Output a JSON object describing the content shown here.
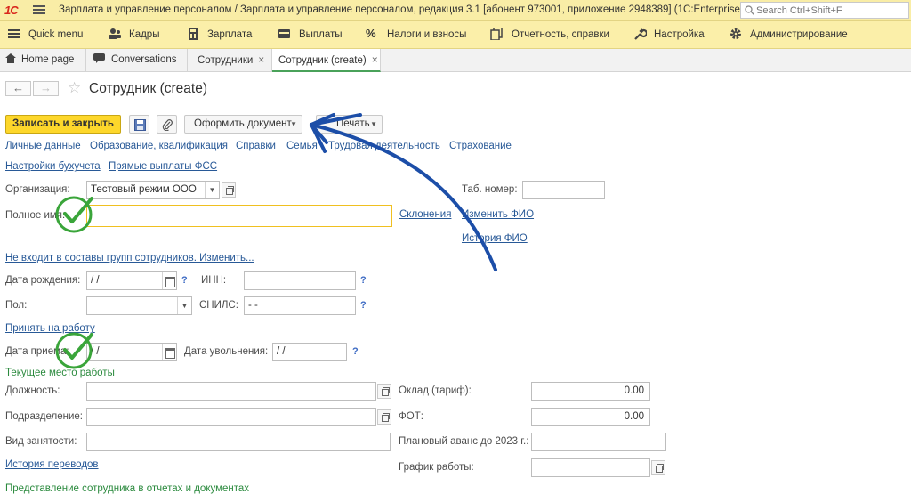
{
  "titlebar": {
    "logo": "1С",
    "title": "Зарплата и управление персоналом / Зарплата и управление персоналом, редакция 3.1 [абонент 973001, приложение 2948389]  (1C:Enterprise)",
    "search_placeholder": "Search Ctrl+Shift+F"
  },
  "menubar": {
    "items": [
      {
        "label": "Quick menu",
        "icon": "hamburger-icon"
      },
      {
        "label": "Кадры",
        "icon": "people-icon"
      },
      {
        "label": "Зарплата",
        "icon": "calculator-icon"
      },
      {
        "label": "Выплаты",
        "icon": "wallet-icon"
      },
      {
        "label": "Налоги и взносы",
        "icon": "percent-icon"
      },
      {
        "label": "Отчетность, справки",
        "icon": "reports-icon"
      },
      {
        "label": "Настройка",
        "icon": "wrench-icon"
      },
      {
        "label": "Администрирование",
        "icon": "gear-icon"
      }
    ]
  },
  "tabs": [
    {
      "label": "Home page",
      "icon": "home-icon"
    },
    {
      "label": "Conversations",
      "icon": "chat-icon"
    },
    {
      "label": "Сотрудники",
      "close": "×"
    },
    {
      "label": "Сотрудник (create)",
      "close": "×"
    }
  ],
  "form": {
    "title": "Сотрудник (create)",
    "nav_back": "←",
    "nav_forward": "→",
    "star": "☆"
  },
  "toolbar": {
    "save_close": "Записать и закрыть",
    "issue_document": "Оформить документ",
    "print": "Печать"
  },
  "links_row1": [
    "Личные данные",
    "Образование, квалификация",
    "Справки",
    "Семья",
    "Трудовая деятельность",
    "Страхование"
  ],
  "links_row2": [
    "Настройки бухучета",
    "Прямые выплаты ФСС"
  ],
  "fields": {
    "org_label": "Организация:",
    "org_value": "Тестовый режим ООО",
    "tab_num_label": "Таб. номер:",
    "fullname_label": "Полное имя:",
    "declension_link": "Склонения",
    "change_fio_link": "Изменить ФИО",
    "history_fio_link": "История ФИО",
    "groups_link": "Не входит в составы групп сотрудников. Изменить...",
    "birth_label": "Дата рождения:",
    "birth_value": " /  / ",
    "inn_label": "ИНН:",
    "gender_label": "Пол:",
    "snils_label": "СНИЛС:",
    "snils_value": "  -   -  ",
    "hire_link": "Принять на работу",
    "hire_date_label": "Дата приема:",
    "hire_date_value": " /  / ",
    "fire_date_label": "Дата увольнения:",
    "fire_date_value": " /  / ",
    "current_job": "Текущее место работы",
    "position_label": "Должность:",
    "salary_label": "Оклад (тариф):",
    "salary_value": "0.00",
    "department_label": "Подразделение:",
    "fot_label": "ФОТ:",
    "fot_value": "0.00",
    "employment_label": "Вид занятости:",
    "advance_label": "Плановый аванс до 2023 г.:",
    "transfers_link": "История переводов",
    "schedule_label": "График работы:",
    "presentation": "Представление сотрудника в отчетах и документах",
    "help": "?"
  },
  "colors": {
    "accent_yellow": "#fdd72b",
    "link_blue": "#285997",
    "green_heading": "#2b8a3e",
    "annotation_arrow": "#1c4ea8",
    "annotation_check": "#3aa53a"
  }
}
